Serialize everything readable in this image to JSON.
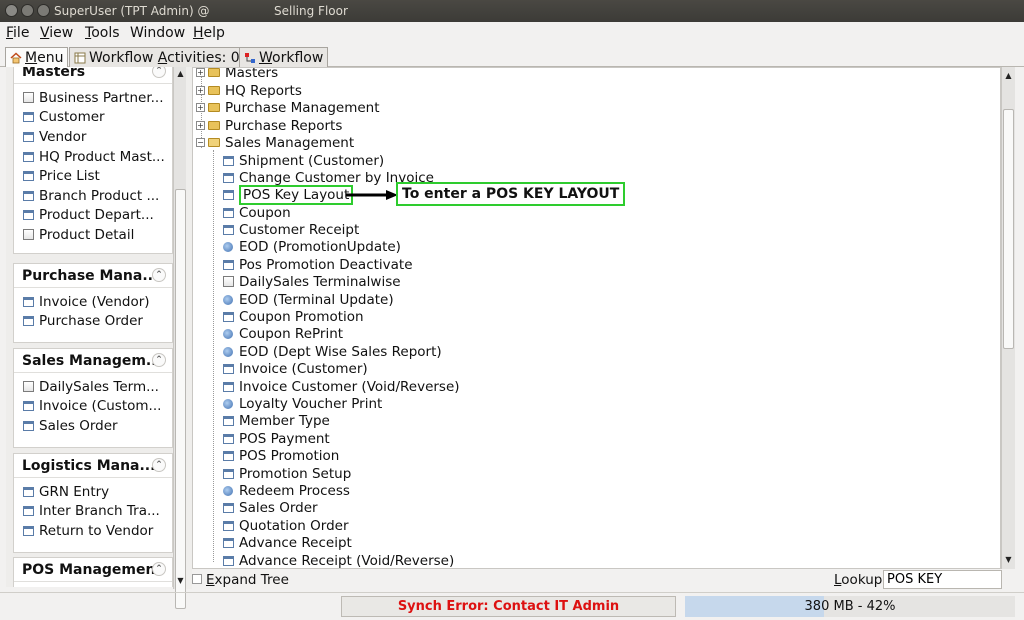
{
  "window": {
    "title_left": "SuperUser (TPT Admin) @",
    "title_center": "Selling Floor"
  },
  "menubar": [
    {
      "pre": "",
      "key": "F",
      "rest": "ile"
    },
    {
      "pre": "",
      "key": "V",
      "rest": "iew"
    },
    {
      "pre": "",
      "key": "T",
      "rest": "ools"
    },
    {
      "pre": "",
      "key": "",
      "rest": "Window"
    },
    {
      "pre": "",
      "key": "H",
      "rest": "elp"
    }
  ],
  "tabs": {
    "menu": {
      "key": "M",
      "rest": "enu"
    },
    "activities": {
      "pre": "Workflow ",
      "key": "A",
      "rest": "ctivities: 0"
    },
    "workflow": {
      "key": "W",
      "rest": "orkflow"
    }
  },
  "left_sections": [
    {
      "title": "Masters",
      "items": [
        {
          "icon": "doc",
          "label": "Business Partner..."
        },
        {
          "icon": "win",
          "label": "Customer"
        },
        {
          "icon": "win",
          "label": "Vendor"
        },
        {
          "icon": "win",
          "label": "HQ Product Mast..."
        },
        {
          "icon": "win",
          "label": "Price List"
        },
        {
          "icon": "win",
          "label": "Branch Product ..."
        },
        {
          "icon": "win",
          "label": "Product Depart..."
        },
        {
          "icon": "doc",
          "label": "Product Detail"
        }
      ]
    },
    {
      "title": "Purchase Mana...",
      "items": [
        {
          "icon": "win",
          "label": "Invoice (Vendor)"
        },
        {
          "icon": "win",
          "label": "Purchase Order"
        }
      ]
    },
    {
      "title": "Sales Managem...",
      "items": [
        {
          "icon": "doc",
          "label": "DailySales Term..."
        },
        {
          "icon": "win",
          "label": "Invoice (Custom..."
        },
        {
          "icon": "win",
          "label": "Sales Order"
        }
      ]
    },
    {
      "title": "Logistics Mana...",
      "items": [
        {
          "icon": "win",
          "label": "GRN Entry"
        },
        {
          "icon": "win",
          "label": "Inter Branch Tra..."
        },
        {
          "icon": "win",
          "label": "Return to Vendor"
        }
      ]
    },
    {
      "title": "POS Management",
      "items": []
    }
  ],
  "tree": {
    "folders": [
      {
        "label": "Masters",
        "expander": "+"
      },
      {
        "label": "HQ Reports",
        "expander": "+"
      },
      {
        "label": "Purchase Management",
        "expander": "+"
      },
      {
        "label": "Purchase Reports",
        "expander": "+"
      },
      {
        "label": "Sales Management",
        "expander": "−"
      }
    ],
    "children": [
      {
        "icon": "win",
        "label": "Shipment (Customer)"
      },
      {
        "icon": "win",
        "label": "Change Customer by Invoice"
      },
      {
        "icon": "win",
        "label": "POS Key Layout",
        "highlight": true
      },
      {
        "icon": "win",
        "label": "Coupon"
      },
      {
        "icon": "win",
        "label": "Customer Receipt"
      },
      {
        "icon": "proc",
        "label": "EOD (PromotionUpdate)"
      },
      {
        "icon": "win",
        "label": "Pos Promotion Deactivate"
      },
      {
        "icon": "doc",
        "label": "DailySales Terminalwise"
      },
      {
        "icon": "proc",
        "label": "EOD (Terminal Update)"
      },
      {
        "icon": "win",
        "label": "Coupon Promotion"
      },
      {
        "icon": "proc",
        "label": "Coupon RePrint"
      },
      {
        "icon": "proc",
        "label": "EOD (Dept Wise Sales Report)"
      },
      {
        "icon": "win",
        "label": "Invoice (Customer)"
      },
      {
        "icon": "win",
        "label": "Invoice Customer (Void/Reverse)"
      },
      {
        "icon": "proc",
        "label": "Loyalty Voucher Print"
      },
      {
        "icon": "win",
        "label": "Member Type"
      },
      {
        "icon": "win",
        "label": "POS Payment"
      },
      {
        "icon": "win",
        "label": "POS Promotion"
      },
      {
        "icon": "win",
        "label": "Promotion Setup"
      },
      {
        "icon": "proc",
        "label": "Redeem Process"
      },
      {
        "icon": "win",
        "label": "Sales Order"
      },
      {
        "icon": "win",
        "label": "Quotation Order"
      },
      {
        "icon": "win",
        "label": "Advance Receipt"
      },
      {
        "icon": "win",
        "label": "Advance Receipt (Void/Reverse)"
      }
    ]
  },
  "annotation": {
    "text": "To enter a POS KEY LAYOUT"
  },
  "bottom": {
    "expand_key": "E",
    "expand_rest": "xpand Tree",
    "lookup_key": "L",
    "lookup_rest": "ookup",
    "lookup_value": "POS KEY"
  },
  "status": {
    "synch_error": "Synch Error: Contact IT Admin",
    "memory": "380 MB - 42%",
    "memory_fraction": 0.42
  },
  "colors": {
    "highlight": "#2ecc2e",
    "error": "#dd1111"
  }
}
